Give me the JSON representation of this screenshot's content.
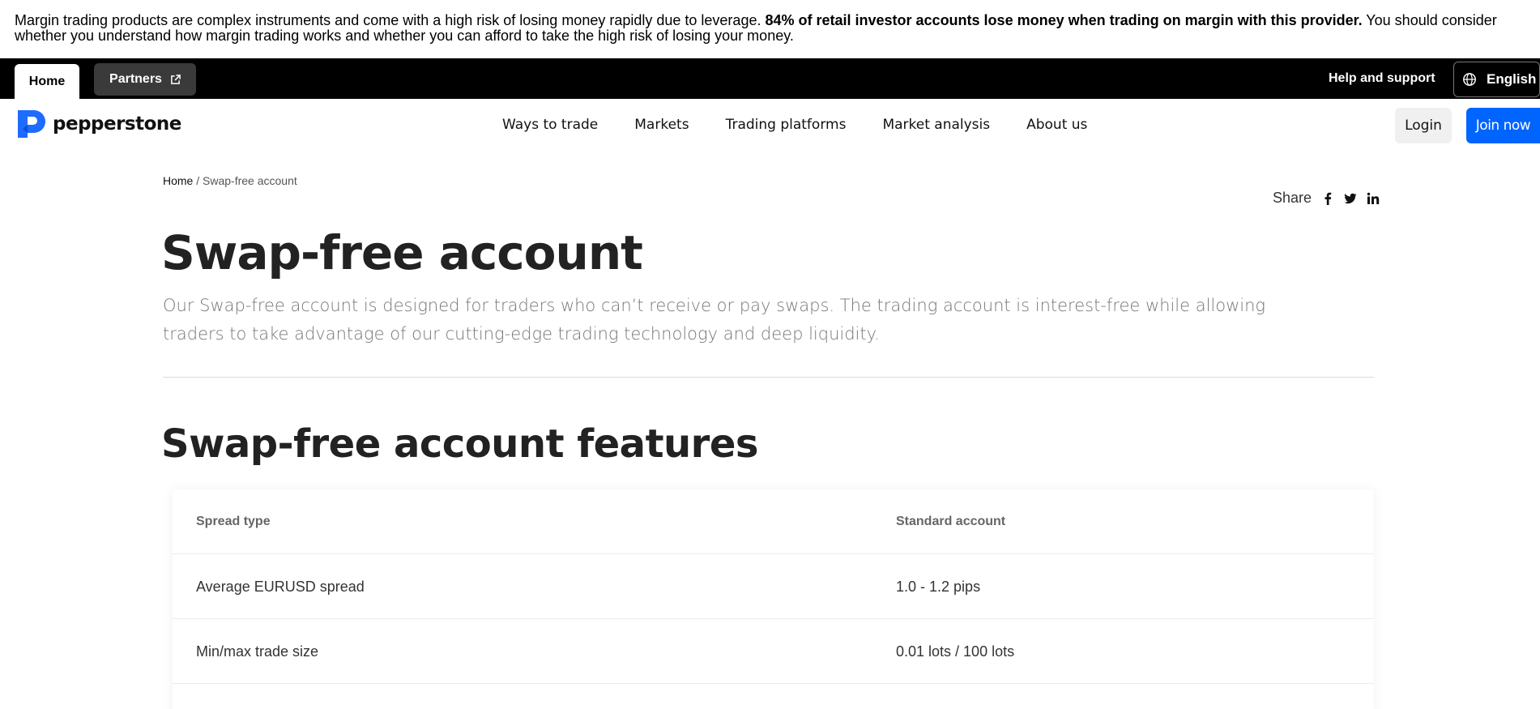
{
  "risk_banner": {
    "text_before": "Margin trading products are complex instruments and come with a high risk of losing money rapidly due to leverage. ",
    "text_bold": "84% of retail investor accounts lose money when trading on margin with this provider.",
    "text_after": " You should consider whether you understand how margin trading works and whether you can afford to take the high risk of losing your money."
  },
  "topbar": {
    "home_label": "Home",
    "partners_label": "Partners",
    "help_label": "Help and support",
    "language_label": "English"
  },
  "nav": {
    "logo_text": "pepperstone",
    "links": [
      "Ways to trade",
      "Markets",
      "Trading platforms",
      "Market analysis",
      "About us"
    ],
    "login_label": "Login",
    "join_label": "Join now"
  },
  "breadcrumb": {
    "home": "Home",
    "separator": " / ",
    "current": "Swap-free account"
  },
  "share": {
    "label": "Share"
  },
  "page": {
    "title": "Swap-free account",
    "intro": "Our Swap-free account is designed for traders who can’t receive or pay swaps. The trading account is interest-free while allowing traders to take advantage of our cutting-edge trading technology and deep liquidity.",
    "section_title": "Swap-free account features"
  },
  "table": {
    "headers": [
      "Spread type",
      "Standard account"
    ],
    "rows": [
      [
        "Average EURUSD spread",
        "1.0 - 1.2 pips"
      ],
      [
        "Min/max trade size",
        "0.01 lots / 100 lots"
      ]
    ]
  },
  "colors": {
    "brand_blue": "#0064ff",
    "topbar_bg": "#000000"
  }
}
